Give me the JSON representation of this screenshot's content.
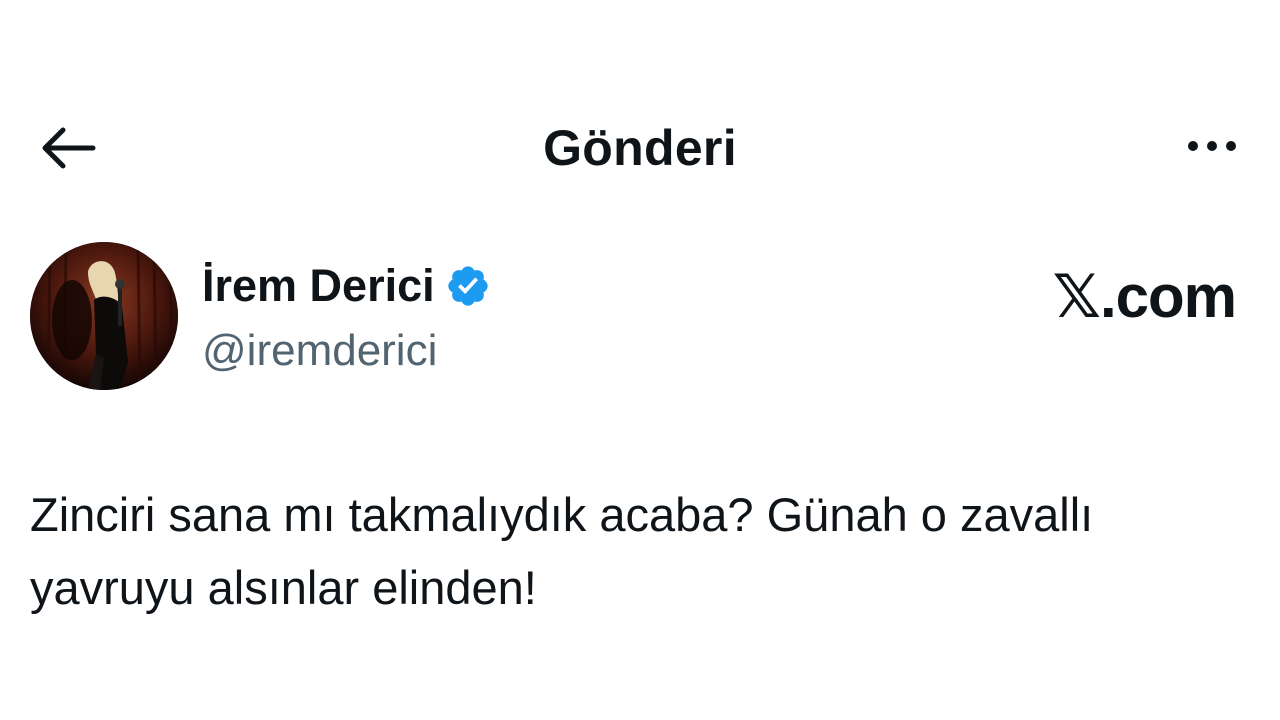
{
  "header": {
    "title": "Gönderi",
    "back_icon": "arrow-left-icon",
    "more_icon": "more-horizontal-icon"
  },
  "author": {
    "name": "İrem Derici",
    "handle": "@iremderici",
    "verified": true,
    "verified_color": "#1d9bf0"
  },
  "source": {
    "label": "𝕏.com"
  },
  "tweet": {
    "text": "Zinciri sana mı takmalıydık acaba? Günah o zavallı yavruyu alsınlar elinden!"
  },
  "colors": {
    "text_primary": "#0f1419",
    "text_secondary": "#536471",
    "background": "#ffffff"
  }
}
